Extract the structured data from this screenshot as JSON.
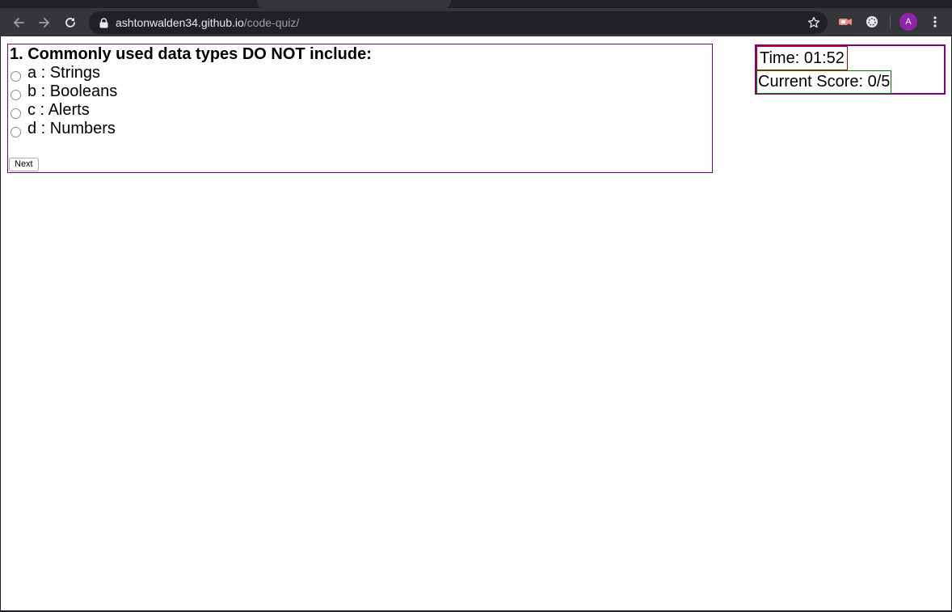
{
  "browser": {
    "url_host": "ashtonwalden34.github.io",
    "url_path": "/code-quiz/",
    "avatar_letter": "A",
    "icons": [
      "back-icon",
      "forward-icon",
      "reload-icon",
      "lock-icon",
      "star-icon",
      "extension-icon",
      "extension-icon",
      "kebab-menu-icon"
    ]
  },
  "quiz": {
    "question": "1. Commonly used data types DO NOT include:",
    "choices": [
      {
        "label": "a : Strings"
      },
      {
        "label": "b : Booleans"
      },
      {
        "label": "c : Alerts"
      },
      {
        "label": "d : Numbers"
      }
    ],
    "next_label": "Next"
  },
  "stats": {
    "time": "Time: 01:52",
    "score": "Current Score: 0/5"
  },
  "colors": {
    "quiz_border": "#800080",
    "timer_border": "#c00000",
    "score_border": "#008000",
    "avatar_bg": "#8e24aa"
  }
}
